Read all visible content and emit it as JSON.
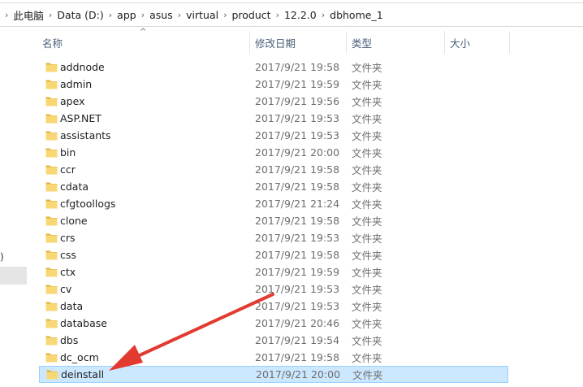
{
  "breadcrumb": [
    "此电脑",
    "Data (D:)",
    "app",
    "asus",
    "virtual",
    "product",
    "12.2.0",
    "dbhome_1"
  ],
  "nav": {
    "partial_label": ")"
  },
  "columns": {
    "name": "名称",
    "date": "修改日期",
    "type": "类型",
    "size": "大小"
  },
  "sort_arrow": "^",
  "files": [
    {
      "name": "addnode",
      "date": "2017/9/21 19:58",
      "type": "文件夹"
    },
    {
      "name": "admin",
      "date": "2017/9/21 19:59",
      "type": "文件夹"
    },
    {
      "name": "apex",
      "date": "2017/9/21 19:56",
      "type": "文件夹"
    },
    {
      "name": "ASP.NET",
      "date": "2017/9/21 19:53",
      "type": "文件夹"
    },
    {
      "name": "assistants",
      "date": "2017/9/21 19:53",
      "type": "文件夹"
    },
    {
      "name": "bin",
      "date": "2017/9/21 20:00",
      "type": "文件夹"
    },
    {
      "name": "ccr",
      "date": "2017/9/21 19:58",
      "type": "文件夹"
    },
    {
      "name": "cdata",
      "date": "2017/9/21 19:58",
      "type": "文件夹"
    },
    {
      "name": "cfgtoollogs",
      "date": "2017/9/21 21:24",
      "type": "文件夹"
    },
    {
      "name": "clone",
      "date": "2017/9/21 19:58",
      "type": "文件夹"
    },
    {
      "name": "crs",
      "date": "2017/9/21 19:53",
      "type": "文件夹"
    },
    {
      "name": "css",
      "date": "2017/9/21 19:58",
      "type": "文件夹"
    },
    {
      "name": "ctx",
      "date": "2017/9/21 19:59",
      "type": "文件夹"
    },
    {
      "name": "cv",
      "date": "2017/9/21 19:53",
      "type": "文件夹"
    },
    {
      "name": "data",
      "date": "2017/9/21 19:53",
      "type": "文件夹"
    },
    {
      "name": "database",
      "date": "2017/9/21 20:46",
      "type": "文件夹"
    },
    {
      "name": "dbs",
      "date": "2017/9/21 19:54",
      "type": "文件夹"
    },
    {
      "name": "dc_ocm",
      "date": "2017/9/21 19:58",
      "type": "文件夹"
    },
    {
      "name": "deinstall",
      "date": "2017/9/21 20:00",
      "type": "文件夹",
      "selected": true
    }
  ],
  "colors": {
    "folder": "#f8d775",
    "folder_dark": "#e0b33a",
    "selection": "#cce8ff",
    "annotation_arrow": "#e23a2f"
  },
  "annotation": {
    "icon": "red-arrow-icon",
    "points_to": "deinstall"
  }
}
